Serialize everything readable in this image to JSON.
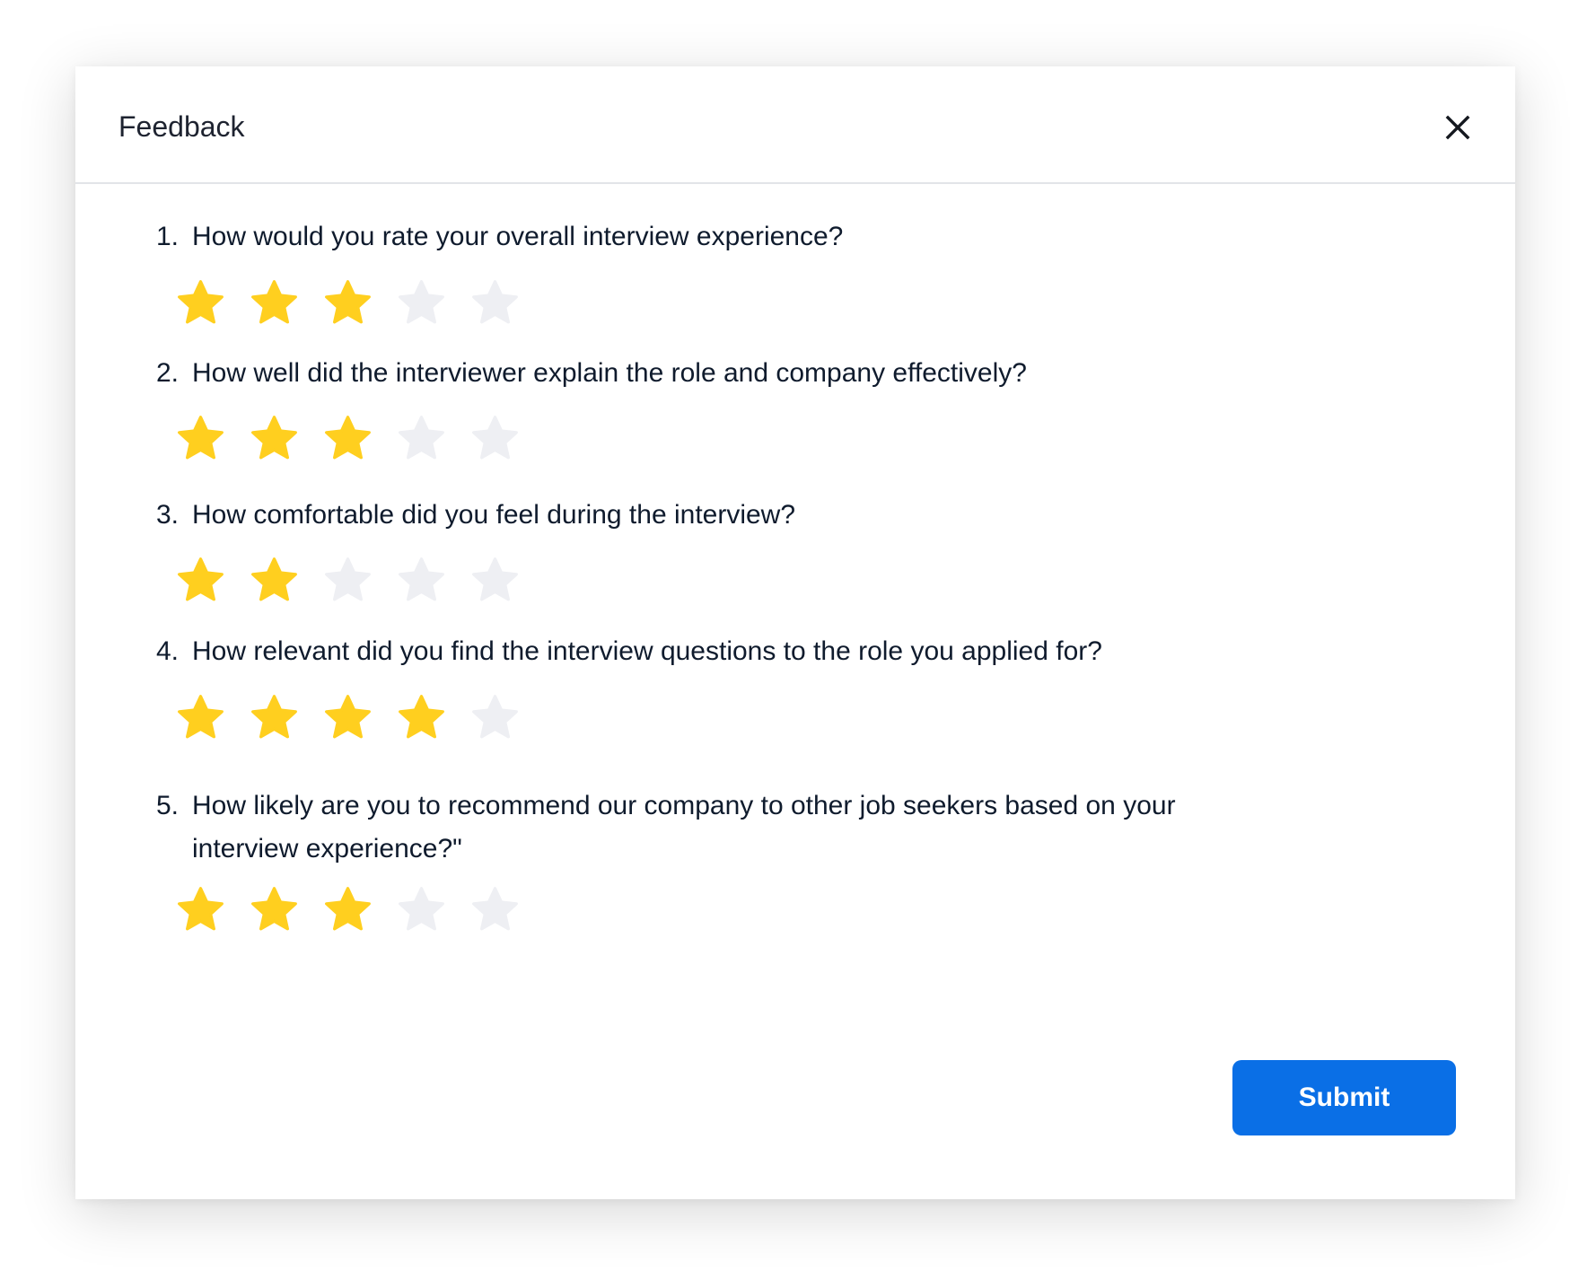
{
  "modal": {
    "title": "Feedback",
    "close_icon": "close-icon",
    "submit_label": "Submit"
  },
  "colors": {
    "star_filled": "#FFCF1F",
    "star_empty": "#EEEFF3",
    "submit_bg": "#0A6FE6"
  },
  "questions": [
    {
      "number": "1.",
      "text": "How would you rate your overall interview experience?",
      "rating": 3,
      "max": 5
    },
    {
      "number": "2.",
      "text": "How well did the interviewer explain the role and company effectively?",
      "rating": 3,
      "max": 5
    },
    {
      "number": "3.",
      "text": "How comfortable did you feel during the interview?",
      "rating": 2,
      "max": 5
    },
    {
      "number": "4.",
      "text": "How relevant did you find the interview questions to the role you applied for?",
      "rating": 4,
      "max": 5
    },
    {
      "number": "5.",
      "text": "How likely are you to recommend our company to other job seekers based on your interview experience?\"",
      "rating": 3,
      "max": 5
    }
  ]
}
